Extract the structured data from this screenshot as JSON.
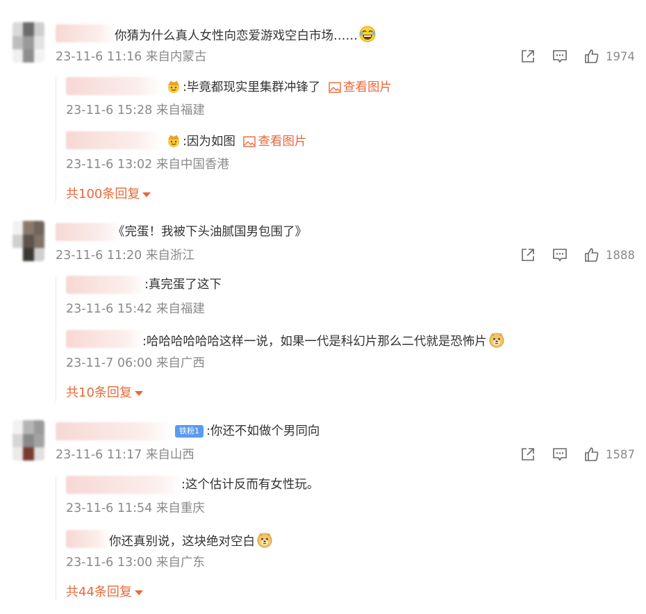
{
  "comments": [
    {
      "text": "你猜为什么真人女性向恋爱游戏空白市场……",
      "meta": "23-11-6 11:16 来自内蒙古",
      "likes": "1974",
      "replies": [
        {
          "text": ":毕竟都现实里集群冲锋了",
          "view_pic": "查看图片",
          "meta": "23-11-6 15:28 来自福建"
        },
        {
          "text": ":因为如图",
          "view_pic": "查看图片",
          "meta": "23-11-6 13:02 来自中国香港"
        }
      ],
      "more": "共100条回复"
    },
    {
      "text": "《完蛋！我被下头油腻国男包围了》",
      "meta": "23-11-6 11:20 来自浙江",
      "likes": "1888",
      "replies": [
        {
          "text": ":真完蛋了这下",
          "meta": "23-11-6 15:42 来自福建"
        },
        {
          "text": ":哈哈哈哈哈哈这样一说，如果一代是科幻片那么二代就是恐怖片",
          "meta": "23-11-7 06:00 来自广西"
        }
      ],
      "more": "共10条回复"
    },
    {
      "badge": "铁粉1",
      "text": ":你还不如做个男同向",
      "meta": "23-11-6 11:17 来自山西",
      "likes": "1587",
      "replies": [
        {
          "text": ":这个估计反而有女性玩。",
          "meta": "23-11-6 11:54 来自重庆"
        },
        {
          "text": "你还真别说，这块绝对空白",
          "meta": "23-11-6 13:00 来自广东"
        }
      ],
      "more": "共44条回复"
    }
  ],
  "icons": {
    "share": "share-icon",
    "comment": "comment-icon",
    "like": "like-icon",
    "image": "image-icon",
    "crown": "crown-badge-icon",
    "laugh": "laugh-cry-emoji-icon",
    "doge": "doge-emoji-icon"
  },
  "colors": {
    "accent": "#e8683a",
    "meta": "#8a8a8a",
    "text": "#333333",
    "badge": "#5a9bf0"
  }
}
